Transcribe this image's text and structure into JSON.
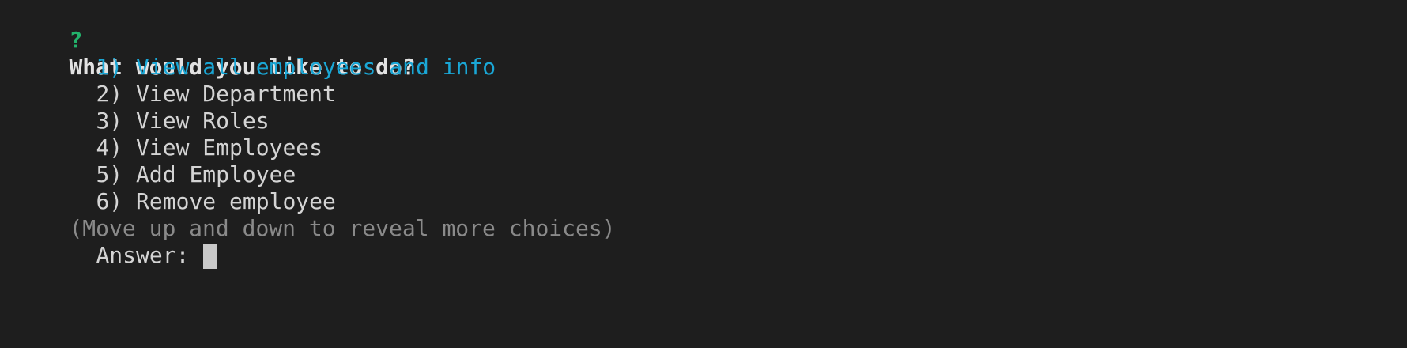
{
  "prompt": {
    "marker": "?",
    "question": "What would you like to do?"
  },
  "choices": [
    {
      "label": "1) View all employees and info",
      "selected": true
    },
    {
      "label": "2) View Department",
      "selected": false
    },
    {
      "label": "3) View Roles",
      "selected": false
    },
    {
      "label": "4) View Employees",
      "selected": false
    },
    {
      "label": "5) Add Employee",
      "selected": false
    },
    {
      "label": "6) Remove employee",
      "selected": false
    }
  ],
  "hint": "(Move up and down to reveal more choices)",
  "answer": {
    "label": "Answer:",
    "value": ""
  },
  "colors": {
    "background": "#1e1e1e",
    "prompt_marker": "#23b26b",
    "selected_choice": "#1aa7d6",
    "hint_text": "#8a8a8a",
    "default_text": "#d4d4d4"
  }
}
